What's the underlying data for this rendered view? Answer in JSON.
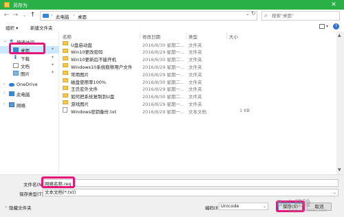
{
  "window": {
    "title": "另存为",
    "title_color": "#2bb048",
    "close_glyph": "✕"
  },
  "nav_buttons": {
    "back": "←",
    "forward": "→",
    "up_dropdown": "⌄",
    "up": "↑"
  },
  "address": {
    "crumbs": [
      "此电脑",
      "桌面"
    ],
    "separator": "›"
  },
  "search": {
    "placeholder": "搜索\"桌面\""
  },
  "toolbar": {
    "organize": "组织 ▾",
    "new_folder": "新建文件夹"
  },
  "navpane": {
    "items": [
      {
        "label": "快速访问",
        "icon": "star-icon",
        "indent": 0,
        "pinned": false
      },
      {
        "label": "桌面",
        "icon": "desktop-icon",
        "indent": 1,
        "pinned": true,
        "selected": true
      },
      {
        "label": "下载",
        "icon": "download-icon",
        "indent": 1,
        "pinned": true
      },
      {
        "label": "文档",
        "icon": "document-icon",
        "indent": 1,
        "pinned": true
      },
      {
        "label": "图片",
        "icon": "picture-icon",
        "indent": 1,
        "pinned": true
      },
      {
        "label": "OneDrive",
        "icon": "cloud-icon",
        "indent": 0,
        "pinned": false
      },
      {
        "label": "此电脑",
        "icon": "computer-icon",
        "indent": 0,
        "pinned": false
      },
      {
        "label": "网络",
        "icon": "network-icon",
        "indent": 0,
        "pinned": false
      }
    ],
    "pin_glyph": "✦"
  },
  "columns": {
    "name": "名称",
    "date": "修改日期",
    "type": "类型",
    "size": "大小"
  },
  "files": [
    {
      "name": "U盘启动盘",
      "date": "2016/8/30 星期二...",
      "type": "文件夹",
      "size": "",
      "kind": "folder"
    },
    {
      "name": "Win10更改密码",
      "date": "2016/8/29 星期一...",
      "type": "文件夹",
      "size": "",
      "kind": "folder"
    },
    {
      "name": "Win10更新后不能开机",
      "date": "2016/8/30 星期二...",
      "type": "文件夹",
      "size": "",
      "kind": "folder"
    },
    {
      "name": "Windows10系统稳移用户文件",
      "date": "2016/8/29 星期一...",
      "type": "文件夹",
      "size": "",
      "kind": "folder"
    },
    {
      "name": "常用图片",
      "date": "2016/8/29 星期一...",
      "type": "文件夹",
      "size": "",
      "kind": "folder"
    },
    {
      "name": "磁盘使用率100%",
      "date": "2016/8/30 星期二...",
      "type": "文件夹",
      "size": "",
      "kind": "folder"
    },
    {
      "name": "王氏宏外文件",
      "date": "2016/8/29 星期一...",
      "type": "文件夹",
      "size": "",
      "kind": "folder"
    },
    {
      "name": "如何把系统复制到U盘",
      "date": "2016/8/30 星期二...",
      "type": "文件夹",
      "size": "",
      "kind": "folder"
    },
    {
      "name": "游戏图片",
      "date": "2016/8/29 星期一...",
      "type": "文件夹",
      "size": "",
      "kind": "folder"
    },
    {
      "name": "Windows密钥备份.txt",
      "date": "2016/8/29 星期一...",
      "type": "文本文档",
      "size": "1 KB",
      "kind": "txt"
    }
  ],
  "form": {
    "filename_label": "文件名(N):",
    "filename_value": "网络名称.reg",
    "savetype_label": "保存类型(T):",
    "savetype_value": "文本文档(*.txt)",
    "encoding_label": "编码(E):",
    "encoding_value": "Unicode",
    "save_button": "保存(S)",
    "cancel_button": "取消",
    "hide_folders": "隐藏文件夹"
  },
  "watermark": {
    "text": "Bai 经验",
    "sub": "jingyan.baidu.com"
  },
  "highlight_color": "#e6157a"
}
